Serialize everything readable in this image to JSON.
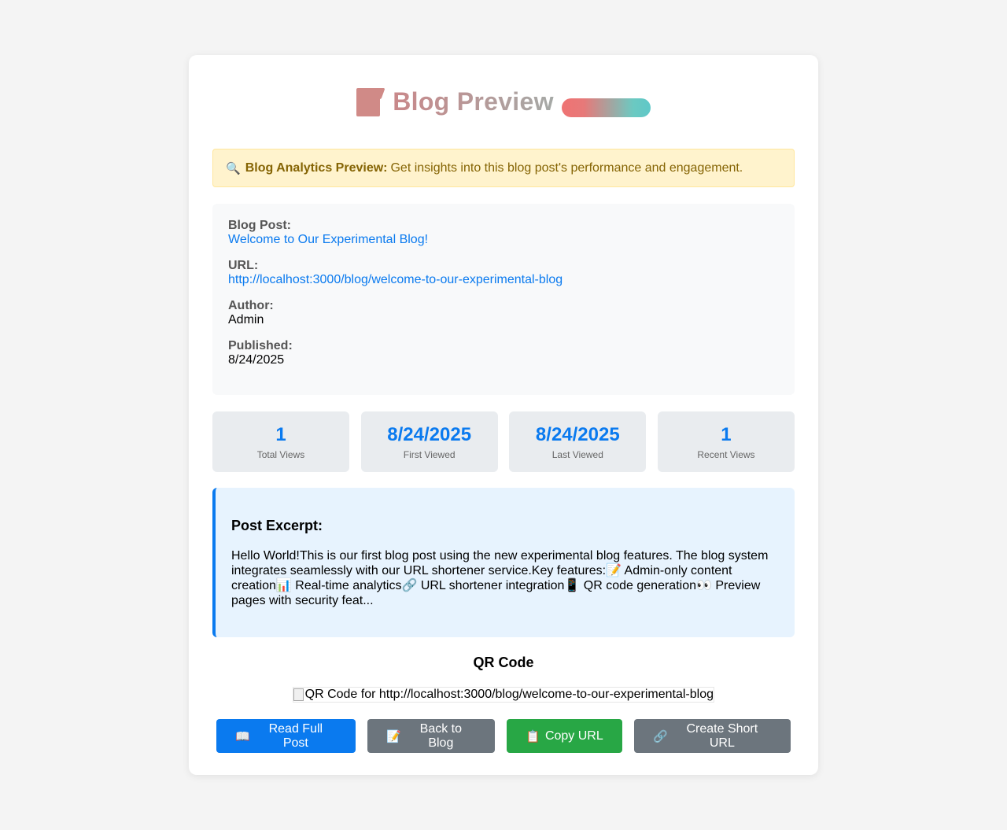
{
  "header": {
    "icon": "memo-icon",
    "title": "Blog Preview"
  },
  "notice": {
    "icon": "magnifier-icon",
    "icon_glyph": "🔍",
    "label": "Blog Analytics Preview:",
    "text": "Get insights into this blog post's performance and engagement."
  },
  "info": {
    "post_label": "Blog Post:",
    "post_value": "Welcome to Our Experimental Blog!",
    "url_label": "URL:",
    "url_value": "http://localhost:3000/blog/welcome-to-our-experimental-blog",
    "author_label": "Author:",
    "author_value": "Admin",
    "published_label": "Published:",
    "published_value": "8/24/2025"
  },
  "stats": [
    {
      "value": "1",
      "label": "Total Views"
    },
    {
      "value": "8/24/2025",
      "label": "First Viewed"
    },
    {
      "value": "8/24/2025",
      "label": "Last Viewed"
    },
    {
      "value": "1",
      "label": "Recent Views"
    }
  ],
  "excerpt": {
    "title": "Post Excerpt:",
    "text": "Hello World!This is our first blog post using the new experimental blog features. The blog system integrates seamlessly with our URL shortener service.Key features:📝 Admin-only content creation📊 Real-time analytics🔗 URL shortener integration📱 QR code generation👀 Preview pages with security feat..."
  },
  "qr": {
    "title": "QR Code",
    "alt": "QR Code for http://localhost:3000/blog/welcome-to-our-experimental-blog"
  },
  "buttons": {
    "read": {
      "icon": "📖",
      "label": "Read Full Post"
    },
    "back": {
      "icon": "📝",
      "label": "Back to Blog"
    },
    "copy": {
      "icon": "📋",
      "label": "Copy URL"
    },
    "short": {
      "icon": "🔗",
      "label": "Create Short URL"
    }
  },
  "colors": {
    "accent": "#0a7aef",
    "success": "#28a745",
    "secondary": "#6c757d",
    "notice_bg": "#fff3cd"
  }
}
